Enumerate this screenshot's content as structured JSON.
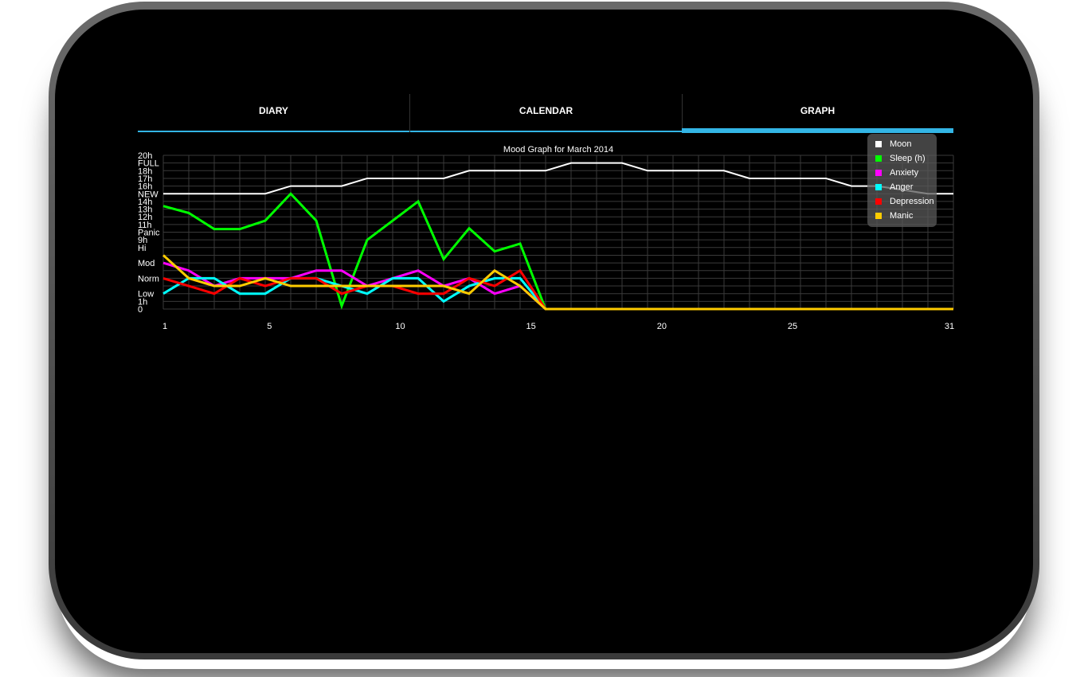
{
  "tabs": [
    {
      "label": "DIARY",
      "selected": false
    },
    {
      "label": "CALENDAR",
      "selected": false
    },
    {
      "label": "GRAPH",
      "selected": true
    }
  ],
  "accent": "#33b5e5",
  "chart_data": {
    "type": "line",
    "title": "Mood Graph for March 2014",
    "x": [
      1,
      2,
      3,
      4,
      5,
      6,
      7,
      8,
      9,
      10,
      11,
      12,
      13,
      14,
      15,
      16,
      17,
      18,
      19,
      20,
      21,
      22,
      23,
      24,
      25,
      26,
      27,
      28,
      29,
      30,
      31,
      32
    ],
    "x_ticks": [
      1,
      5,
      10,
      15,
      20,
      25,
      31
    ],
    "y_range": [
      0,
      20
    ],
    "y_ticks": [
      {
        "v": 20,
        "label": "20h"
      },
      {
        "v": 19,
        "label": "FULL"
      },
      {
        "v": 18,
        "label": "18h"
      },
      {
        "v": 17,
        "label": "17h"
      },
      {
        "v": 16,
        "label": "16h"
      },
      {
        "v": 15,
        "label": "NEW"
      },
      {
        "v": 14,
        "label": "14h"
      },
      {
        "v": 13,
        "label": "13h"
      },
      {
        "v": 12,
        "label": "12h"
      },
      {
        "v": 11,
        "label": "11h"
      },
      {
        "v": 10,
        "label": "Panic"
      },
      {
        "v": 9,
        "label": "9h"
      },
      {
        "v": 8,
        "label": "Hi"
      },
      {
        "v": 6,
        "label": "Mod"
      },
      {
        "v": 4,
        "label": "Norm"
      },
      {
        "v": 2,
        "label": "Low"
      },
      {
        "v": 1,
        "label": "1h"
      },
      {
        "v": 0,
        "label": "0"
      }
    ],
    "grid": true,
    "legend_position": "top-right",
    "series": [
      {
        "name": "Moon",
        "color": "#ffffff",
        "width": 2,
        "values": [
          15,
          15,
          15,
          15,
          15,
          16,
          16,
          16,
          17,
          17,
          17,
          17,
          18,
          18,
          18,
          18,
          19,
          19,
          19,
          18,
          18,
          18,
          18,
          17,
          17,
          17,
          17,
          16,
          16,
          15.5,
          15,
          15
        ]
      },
      {
        "name": "Sleep (h)",
        "color": "#00ff00",
        "width": 3,
        "values": [
          13.4,
          12.5,
          10.4,
          10.4,
          11.5,
          15,
          11.5,
          0.4,
          9,
          11.5,
          14,
          6.5,
          10.5,
          7.5,
          8.5,
          0,
          0,
          0,
          0,
          0,
          0,
          0,
          0,
          0,
          0,
          0,
          0,
          0,
          0,
          0,
          0,
          0
        ]
      },
      {
        "name": "Anxiety",
        "color": "#ff00ff",
        "width": 3,
        "values": [
          6,
          5,
          3,
          4,
          4,
          4,
          5,
          5,
          3,
          4,
          5,
          3,
          4,
          2,
          3,
          0,
          0,
          0,
          0,
          0,
          0,
          0,
          0,
          0,
          0,
          0,
          0,
          0,
          0,
          0,
          0,
          0
        ]
      },
      {
        "name": "Anger",
        "color": "#00ffff",
        "width": 3,
        "values": [
          2,
          4,
          4,
          2,
          2,
          4,
          4,
          3,
          2,
          4,
          4,
          1,
          3,
          4,
          4,
          0,
          0,
          0,
          0,
          0,
          0,
          0,
          0,
          0,
          0,
          0,
          0,
          0,
          0,
          0,
          0,
          0
        ]
      },
      {
        "name": "Depression",
        "color": "#ff0000",
        "width": 3,
        "values": [
          4,
          3,
          2,
          4,
          3,
          4,
          4,
          2,
          3,
          3,
          2,
          2,
          4,
          3,
          5,
          0,
          0,
          0,
          0,
          0,
          0,
          0,
          0,
          0,
          0,
          0,
          0,
          0,
          0,
          0,
          0,
          0
        ]
      },
      {
        "name": "Manic",
        "color": "#ffcc00",
        "width": 3,
        "values": [
          7,
          4,
          3,
          3,
          4,
          3,
          3,
          3,
          3,
          3,
          3,
          3,
          2,
          5,
          3,
          0,
          0,
          0,
          0,
          0,
          0,
          0,
          0,
          0,
          0,
          0,
          0,
          0,
          0,
          0,
          0,
          0
        ]
      }
    ]
  }
}
